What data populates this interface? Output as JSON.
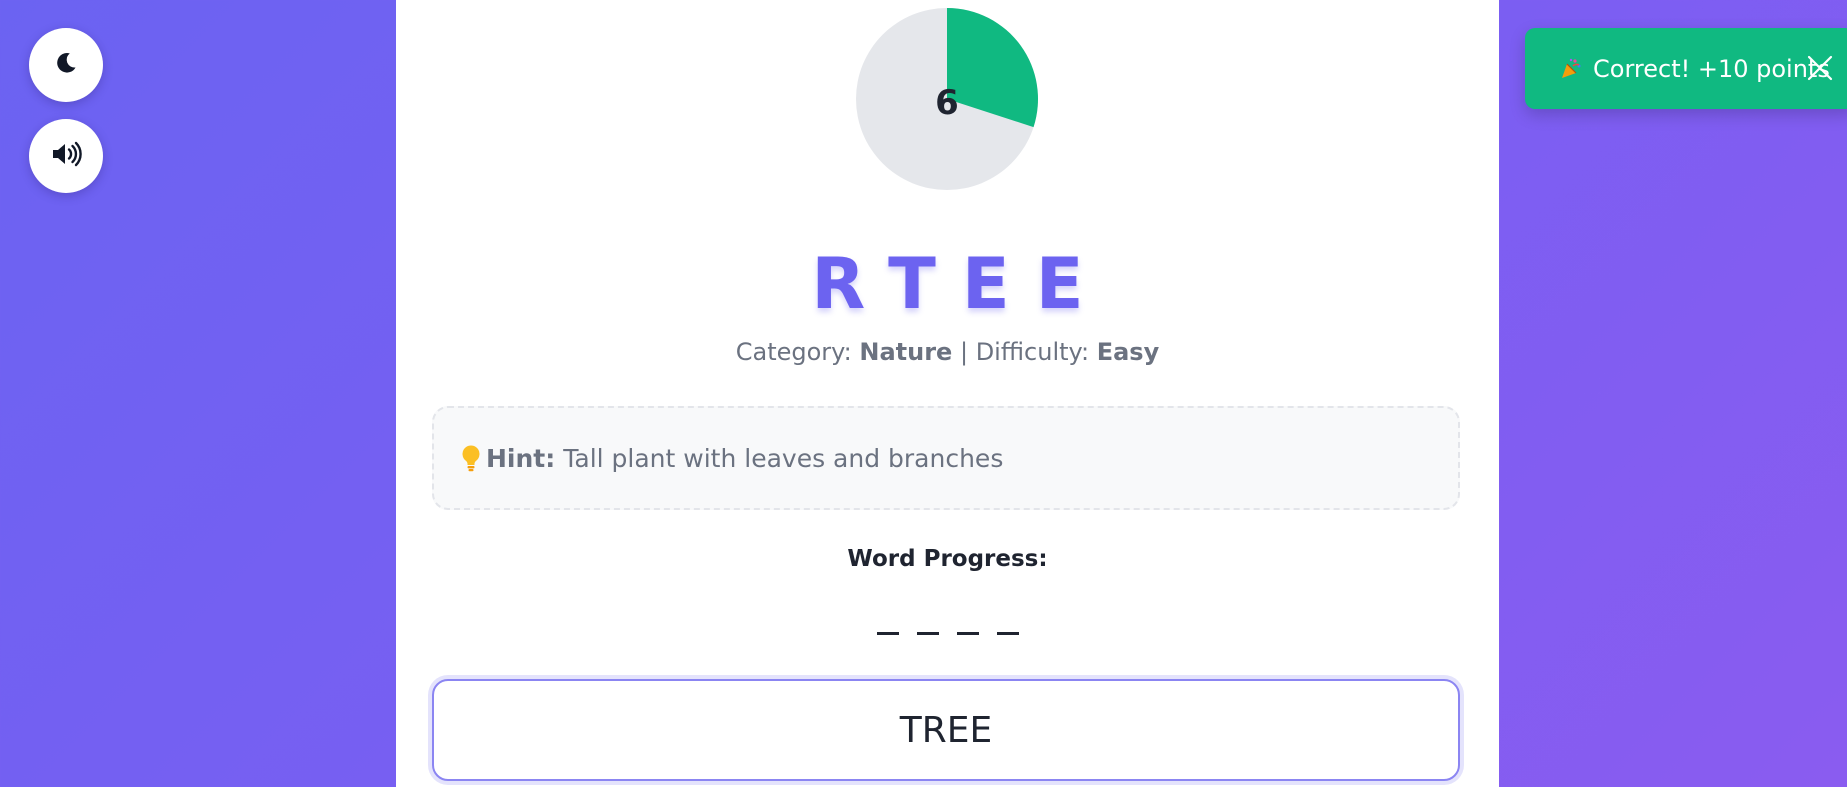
{
  "controls": {
    "theme_icon": "moon-icon",
    "sound_icon": "speaker-icon"
  },
  "timer": {
    "value": "6",
    "elapsed_fraction": 0.3,
    "fill_color": "#10b981",
    "track_color": "#e5e7eb"
  },
  "puzzle": {
    "scrambled_word": "RTEE",
    "category_label": "Category:",
    "category": "Nature",
    "separator": "|",
    "difficulty_label": "Difficulty:",
    "difficulty": "Easy"
  },
  "hint": {
    "icon": "lightbulb-icon",
    "label": "Hint:",
    "text": "Tall plant with leaves and branches"
  },
  "progress": {
    "title": "Word Progress:",
    "blanks": [
      "_",
      "_",
      "_",
      "_"
    ]
  },
  "answer_input": {
    "value": "TREE"
  },
  "toast": {
    "icon": "party-popper-icon",
    "message": "Correct! +10 points",
    "color": "#10b981"
  },
  "colors": {
    "accent": "#6c63f0",
    "success": "#10b981"
  }
}
